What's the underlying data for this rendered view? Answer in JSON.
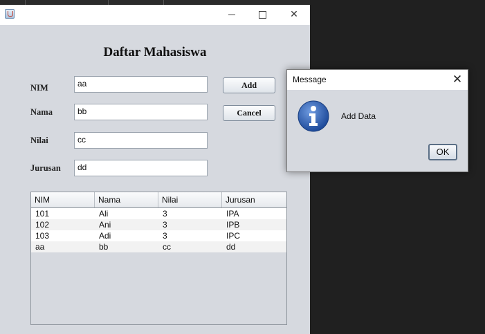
{
  "window": {
    "title_controls": {
      "minimize": "minimize",
      "maximize": "maximize",
      "close": "close"
    }
  },
  "form": {
    "heading": "Daftar Mahasiswa",
    "fields": [
      {
        "label": "NIM",
        "value": "aa"
      },
      {
        "label": "Nama",
        "value": "bb"
      },
      {
        "label": "Nilai",
        "value": "cc"
      },
      {
        "label": "Jurusan",
        "value": "dd"
      }
    ],
    "buttons": {
      "add": "Add",
      "cancel": "Cancel"
    }
  },
  "table": {
    "columns": [
      "NIM",
      "Nama",
      "Nilai",
      "Jurusan"
    ],
    "rows": [
      [
        "101",
        "Ali",
        "3",
        "IPA"
      ],
      [
        "102",
        "Ani",
        "3",
        "IPB"
      ],
      [
        "103",
        "Adi",
        "3",
        "IPC"
      ],
      [
        "aa",
        "bb",
        "cc",
        "dd"
      ]
    ]
  },
  "dialog": {
    "title": "Message",
    "message": "Add Data",
    "ok_label": "OK",
    "icon": "info-icon"
  },
  "colors": {
    "window_bg": "#d6d9df",
    "desktop_bg": "#202020",
    "info_blue": "#2f62b3"
  }
}
